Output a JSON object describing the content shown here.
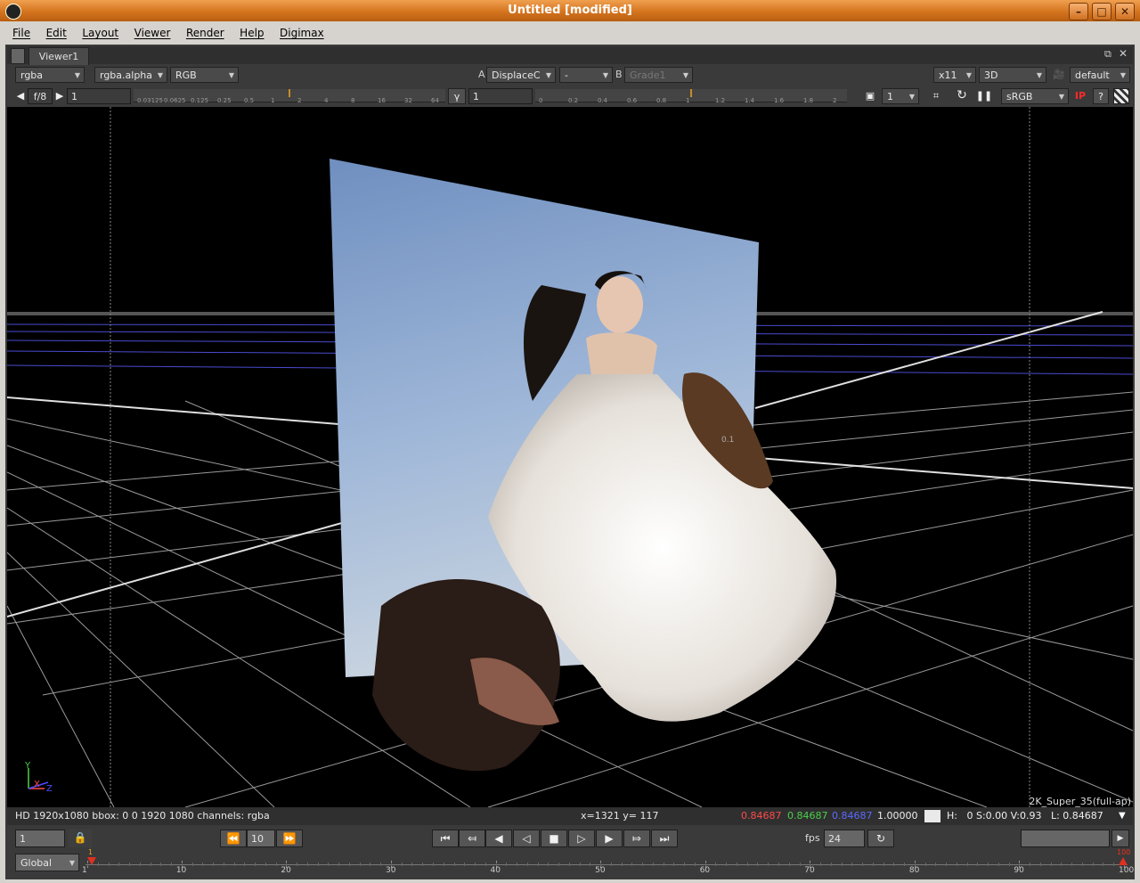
{
  "window": {
    "title": "Untitled [modified]"
  },
  "menu": [
    "File",
    "Edit",
    "Layout",
    "Viewer",
    "Render",
    "Help",
    "Digimax"
  ],
  "tab": {
    "label": "Viewer1"
  },
  "toolbar1": {
    "channels": "rgba",
    "alpha": "rgba.alpha",
    "display_channels": "RGB",
    "input_a_label": "A",
    "input_a": "DisplaceC",
    "compare_mode": "-",
    "input_b_label": "B",
    "input_b": "Grade1",
    "downrez": "x11",
    "view_mode": "3D",
    "camera": "default"
  },
  "toolbar2": {
    "fstop": "f/8",
    "gain": "1",
    "gamma_label": "γ",
    "gamma": "1",
    "gain_ticks": [
      "0.03125",
      "0.0625",
      "0.125",
      "0.25",
      "0.5",
      "1",
      "2",
      "4",
      "8",
      "16",
      "32",
      "64"
    ],
    "gamma_ticks": [
      "0",
      "0.2",
      "0.4",
      "0.6",
      "0.8",
      "1",
      "1.2",
      "1.4",
      "1.6",
      "1.8",
      "2"
    ],
    "proxy": "1",
    "lut": "sRGB",
    "ip": "IP"
  },
  "viewer": {
    "format_label": "2K_Super_35(full-ap)",
    "axis_y": "Y",
    "axis_x": "X",
    "axis_z": "Z",
    "grid_label": "0.1"
  },
  "info": {
    "format": "HD 1920x1080 bbox: 0 0 1920 1080 channels: rgba",
    "coords": "x=1321 y= 117",
    "r": "0.84687",
    "g": "0.84687",
    "b": "0.84687",
    "a": "1.00000",
    "hsv": "H:   0 S:0.00 V:0.93   L: 0.84687",
    "colors": {
      "r": "#ff4a4a",
      "g": "#4ad04a",
      "b": "#5a6aff"
    }
  },
  "transport": {
    "frame": "1",
    "step": "10",
    "fps_label": "fps",
    "fps": "24"
  },
  "timeline": {
    "range_mode": "Global",
    "ticks": [
      "1",
      "10",
      "20",
      "30",
      "40",
      "50",
      "60",
      "70",
      "80",
      "90",
      "100"
    ],
    "start_marker": "1",
    "end_marker": "100"
  }
}
